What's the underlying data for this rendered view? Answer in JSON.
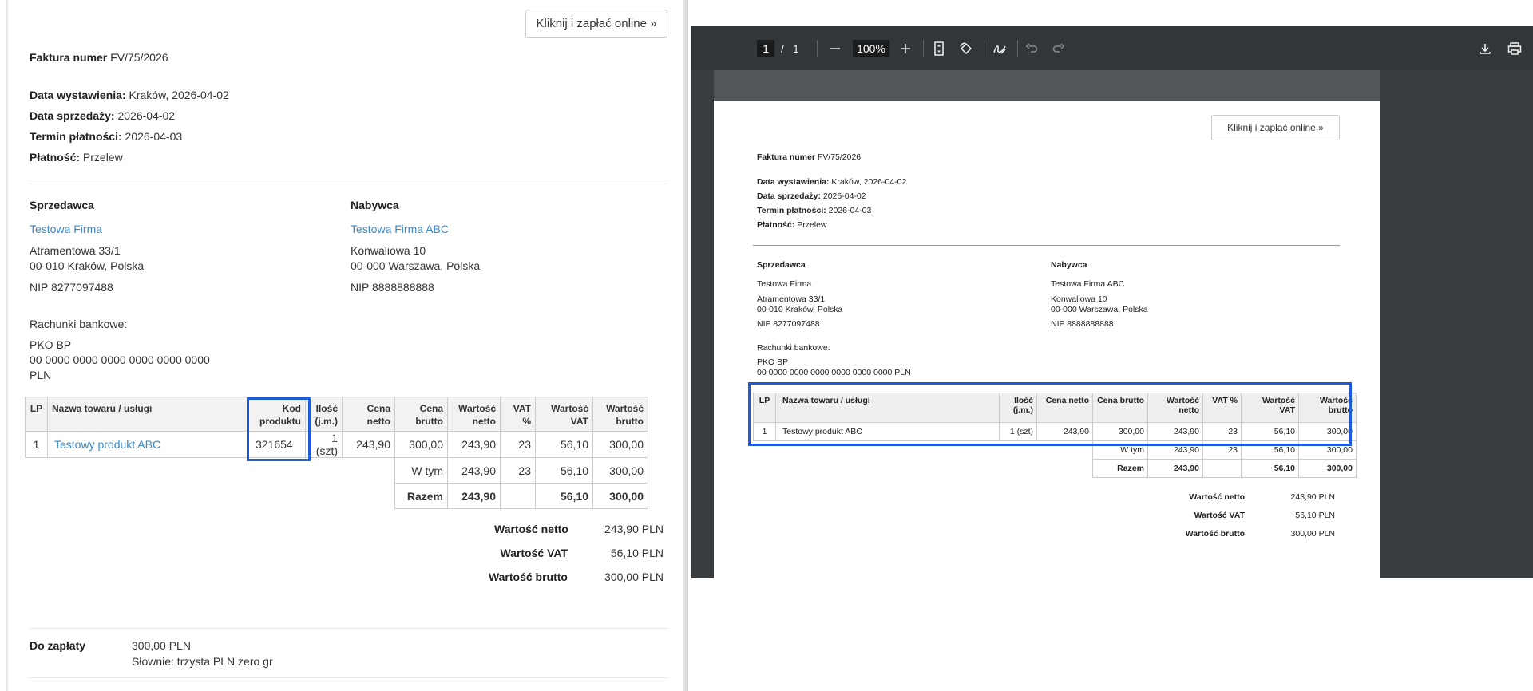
{
  "invoice": {
    "pay_button": "Kliknij i zapłać online »",
    "number_label": "Faktura numer",
    "number": "FV/75/2026",
    "issue_label": "Data wystawienia:",
    "issue_value": "Kraków, 2026-04-02",
    "sale_label": "Data sprzedaży:",
    "sale_value": "2026-04-02",
    "due_label": "Termin płatności:",
    "due_value": "2026-04-03",
    "payment_label": "Płatność:",
    "payment_value": "Przelew",
    "seller": {
      "heading": "Sprzedawca",
      "name": "Testowa Firma",
      "street": "Atramentowa 33/1",
      "city": "00-010 Kraków, Polska",
      "nip": "NIP 8277097488"
    },
    "buyer": {
      "heading": "Nabywca",
      "name": "Testowa Firma ABC",
      "street": "Konwaliowa 10",
      "city": "00-000 Warszawa, Polska",
      "nip": "NIP 8888888888"
    },
    "bank": {
      "heading": "Rachunki bankowe:",
      "name": "PKO BP",
      "account": "00 0000 0000 0000 0000 0000 0000",
      "currency": "PLN"
    },
    "table": {
      "headers_left": [
        "LP",
        "Nazwa towaru / usługi",
        "Kod produktu",
        "Ilość (j.m.)",
        "Cena netto",
        "Cena brutto",
        "Wartość netto",
        "VAT %",
        "Wartość VAT",
        "Wartość brutto"
      ],
      "headers_pdf": [
        "LP",
        "Nazwa towaru / usługi",
        "Ilość (j.m.)",
        "Cena netto",
        "Cena brutto",
        "Wartość netto",
        "VAT %",
        "Wartość VAT",
        "Wartość brutto"
      ],
      "row": {
        "lp": "1",
        "name": "Testowy produkt ABC",
        "code": "321654",
        "qty": "1 (szt)",
        "net_price": "243,90",
        "gross_price": "300,00",
        "net_value": "243,90",
        "vat_pct": "23",
        "vat_value": "56,10",
        "gross_value": "300,00"
      },
      "wtym": {
        "label": "W tym",
        "net": "243,90",
        "vat_pct": "23",
        "vat": "56,10",
        "gross": "300,00"
      },
      "razem": {
        "label": "Razem",
        "net": "243,90",
        "vat": "56,10",
        "gross": "300,00"
      }
    },
    "totals": {
      "net_label": "Wartość netto",
      "net": "243,90 PLN",
      "vat_label": "Wartość VAT",
      "vat": "56,10 PLN",
      "gross_label": "Wartość brutto",
      "gross": "300,00 PLN"
    },
    "to_pay": {
      "label": "Do zapłaty",
      "amount": "300,00 PLN",
      "words": "Słownie: trzysta PLN zero gr"
    }
  },
  "pdf_viewer": {
    "page_current": "1",
    "page_separator": "/",
    "page_total": "1",
    "zoom": "100%"
  }
}
